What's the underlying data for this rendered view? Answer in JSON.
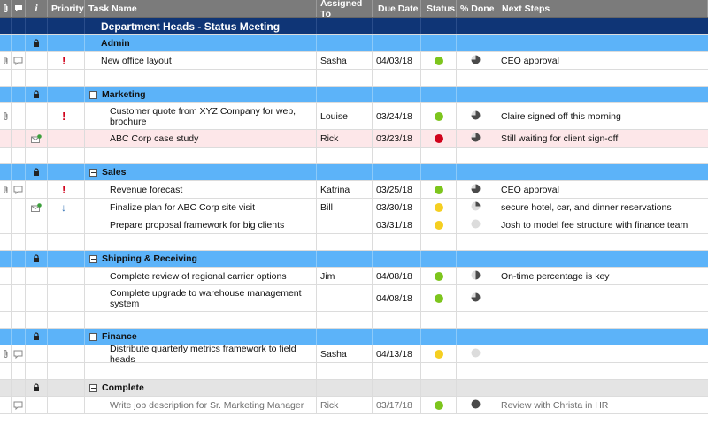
{
  "headers": {
    "priority": "Priority",
    "task": "Task Name",
    "assigned": "Assigned To",
    "due": "Due Date",
    "status": "Status",
    "done": "% Done",
    "next": "Next Steps"
  },
  "colors": {
    "banner": "#0f3576",
    "section": "#5cb3f9",
    "green": "#7dc51d",
    "red": "#d0021b",
    "yellow": "#f5cf21",
    "gray": "#d9d9d9"
  },
  "rows": [
    {
      "type": "banner",
      "task": "Department Heads - Status Meeting"
    },
    {
      "type": "group",
      "task": "Admin",
      "lock": true,
      "collapse": false
    },
    {
      "type": "task",
      "task": "New office layout",
      "assigned": "Sasha",
      "due": "04/03/18",
      "status": "green",
      "pct": 75,
      "next": "CEO approval",
      "priority": "high",
      "attach": true,
      "comment": true
    },
    {
      "type": "blank"
    },
    {
      "type": "group",
      "task": "Marketing",
      "lock": true,
      "collapse": true
    },
    {
      "type": "task",
      "level": 2,
      "task": "Customer quote from XYZ Company for web, brochure",
      "assigned": "Louise",
      "due": "03/24/18",
      "status": "green",
      "pct": 75,
      "next": "Claire signed off this morning",
      "priority": "high",
      "attach": true,
      "tall": true
    },
    {
      "type": "task",
      "level": 2,
      "task": "ABC Corp case study",
      "assigned": "Rick",
      "due": "03/23/18",
      "status": "red",
      "pct": 75,
      "next": "Still waiting for client sign-off",
      "pink": true,
      "mail": true
    },
    {
      "type": "blank"
    },
    {
      "type": "group",
      "task": "Sales",
      "lock": true,
      "collapse": true
    },
    {
      "type": "task",
      "level": 2,
      "task": "Revenue forecast",
      "assigned": "Katrina",
      "due": "03/25/18",
      "status": "green",
      "pct": 75,
      "next": "CEO approval",
      "priority": "high",
      "attach": true,
      "comment": true
    },
    {
      "type": "task",
      "level": 2,
      "task": "Finalize plan for ABC Corp site visit",
      "assigned": "Bill",
      "due": "03/30/18",
      "status": "yellow",
      "pct": 25,
      "next": "secure hotel, car, and dinner reservations",
      "priority": "low",
      "mail": true
    },
    {
      "type": "task",
      "level": 2,
      "task": "Prepare proposal framework for big clients",
      "assigned": "",
      "due": "03/31/18",
      "status": "yellow",
      "pct": 0,
      "next": "Josh to model fee structure with finance team"
    },
    {
      "type": "blank"
    },
    {
      "type": "group",
      "task": "Shipping & Receiving",
      "lock": true,
      "collapse": true
    },
    {
      "type": "task",
      "level": 2,
      "task": "Complete review of regional carrier options",
      "assigned": "Jim",
      "due": "04/08/18",
      "status": "green",
      "pct": 50,
      "next": "On-time percentage is key"
    },
    {
      "type": "task",
      "level": 2,
      "task": "Complete upgrade to warehouse management system",
      "assigned": "",
      "due": "04/08/18",
      "status": "green",
      "pct": 75,
      "next": "",
      "tall": true
    },
    {
      "type": "blank"
    },
    {
      "type": "group",
      "task": "Finance",
      "lock": true,
      "collapse": true
    },
    {
      "type": "task",
      "level": 2,
      "task": "Distribute quarterly metrics framework to field heads",
      "assigned": "Sasha",
      "due": "04/13/18",
      "status": "yellow",
      "pct": 0,
      "next": "",
      "attach": true,
      "comment": true
    },
    {
      "type": "blank"
    },
    {
      "type": "group",
      "task": "Complete",
      "lock": true,
      "collapse": true,
      "gray": true
    },
    {
      "type": "task",
      "level": 2,
      "task": "Write job description for Sr. Marketing Manager",
      "assigned": "Rick",
      "due": "03/17/18",
      "status": "green",
      "pct": 100,
      "next": "Review with Christa in HR",
      "comment": true,
      "done": true
    }
  ]
}
